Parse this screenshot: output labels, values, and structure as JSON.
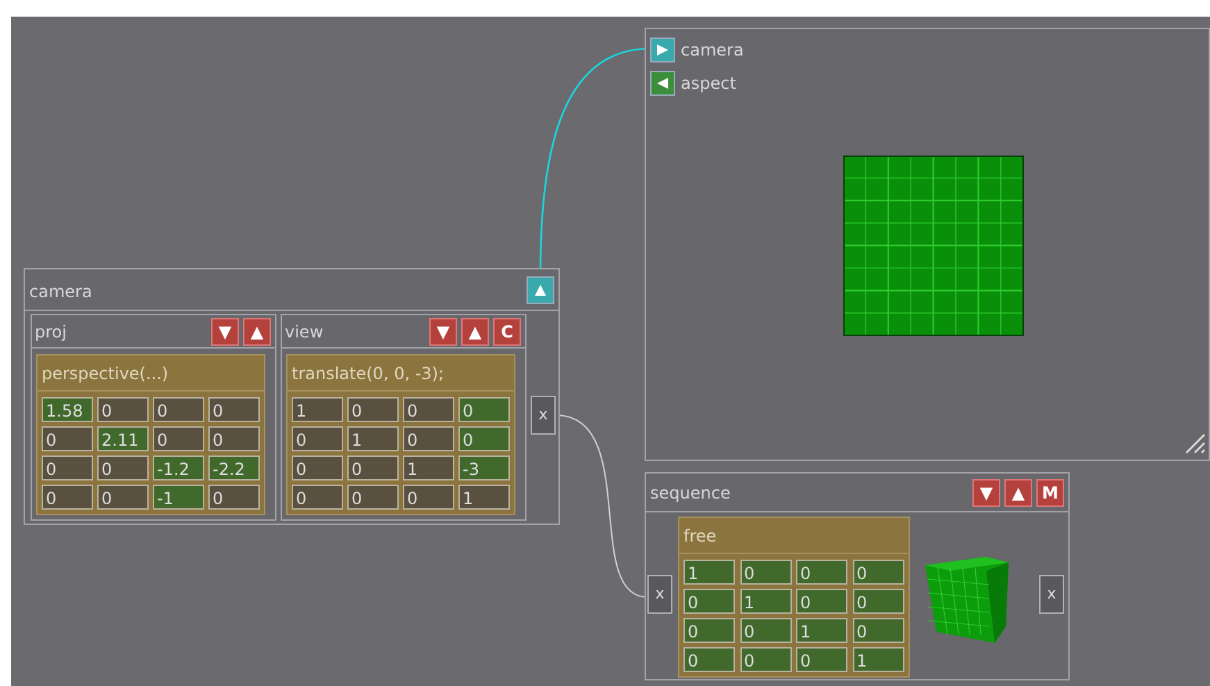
{
  "viewer": {
    "inputs": [
      {
        "label": "camera",
        "kind": "camera",
        "connected": true
      },
      {
        "label": "aspect",
        "kind": "value",
        "connected": false
      }
    ]
  },
  "camera_node": {
    "title": "camera",
    "output": {
      "kind": "camera"
    },
    "panels": [
      {
        "title": "proj",
        "buttons": [
          {
            "label": "▼"
          },
          {
            "label": "▲"
          }
        ],
        "matrix": {
          "title": "perspective(...)",
          "rows": [
            [
              {
                "value": "1.58",
                "active": true
              },
              {
                "value": "0",
                "active": false
              },
              {
                "value": "0",
                "active": false
              },
              {
                "value": "0",
                "active": false
              }
            ],
            [
              {
                "value": "0",
                "active": false
              },
              {
                "value": "2.11",
                "active": true
              },
              {
                "value": "0",
                "active": false
              },
              {
                "value": "0",
                "active": false
              }
            ],
            [
              {
                "value": "0",
                "active": false
              },
              {
                "value": "0",
                "active": false
              },
              {
                "value": "-1.2",
                "active": true
              },
              {
                "value": "-2.2",
                "active": true
              }
            ],
            [
              {
                "value": "0",
                "active": false
              },
              {
                "value": "0",
                "active": false
              },
              {
                "value": "-1",
                "active": true
              },
              {
                "value": "0",
                "active": false
              }
            ]
          ]
        }
      },
      {
        "title": "view",
        "buttons": [
          {
            "label": "▼"
          },
          {
            "label": "▲"
          },
          {
            "label": "C"
          }
        ],
        "matrix": {
          "title": "translate(0, 0, -3);",
          "rows": [
            [
              {
                "value": "1",
                "active": false
              },
              {
                "value": "0",
                "active": false
              },
              {
                "value": "0",
                "active": false
              },
              {
                "value": "0",
                "active": true
              }
            ],
            [
              {
                "value": "0",
                "active": false
              },
              {
                "value": "1",
                "active": false
              },
              {
                "value": "0",
                "active": false
              },
              {
                "value": "0",
                "active": true
              }
            ],
            [
              {
                "value": "0",
                "active": false
              },
              {
                "value": "0",
                "active": false
              },
              {
                "value": "1",
                "active": false
              },
              {
                "value": "-3",
                "active": true
              }
            ],
            [
              {
                "value": "0",
                "active": false
              },
              {
                "value": "0",
                "active": false
              },
              {
                "value": "0",
                "active": false
              },
              {
                "value": "1",
                "active": false
              }
            ]
          ]
        }
      }
    ],
    "port": "x"
  },
  "sequence_node": {
    "title": "sequence",
    "buttons": [
      {
        "label": "▼"
      },
      {
        "label": "▲"
      },
      {
        "label": "M"
      }
    ],
    "input_port": "x",
    "output_port": "x",
    "matrix": {
      "title": "free",
      "rows": [
        [
          {
            "value": "1",
            "active": true
          },
          {
            "value": "0",
            "active": true
          },
          {
            "value": "0",
            "active": true
          },
          {
            "value": "0",
            "active": true
          }
        ],
        [
          {
            "value": "0",
            "active": true
          },
          {
            "value": "1",
            "active": true
          },
          {
            "value": "0",
            "active": true
          },
          {
            "value": "0",
            "active": true
          }
        ],
        [
          {
            "value": "0",
            "active": true
          },
          {
            "value": "0",
            "active": true
          },
          {
            "value": "1",
            "active": true
          },
          {
            "value": "0",
            "active": true
          }
        ],
        [
          {
            "value": "0",
            "active": true
          },
          {
            "value": "0",
            "active": true
          },
          {
            "value": "0",
            "active": true
          },
          {
            "value": "1",
            "active": true
          }
        ]
      ]
    }
  }
}
